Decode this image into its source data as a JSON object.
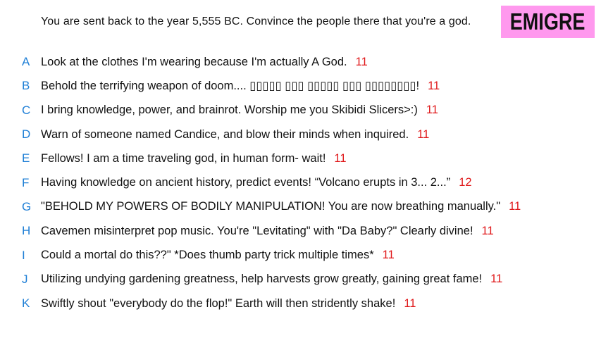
{
  "prompt": "You are sent back to the year 5,555 BC. Convince the people there that you're a god.",
  "badge": "EMIGRE",
  "colors": {
    "letter": "#1f7fd6",
    "score": "#e0191b",
    "badge_bg": "#ff99ee"
  },
  "entries": [
    {
      "letter": "A",
      "text": "Look at the clothes I'm wearing because I'm actually A God.",
      "score": "11"
    },
    {
      "letter": "B",
      "text": "Behold the terrifying weapon of doom.... ▯▯▯▯▯ ▯▯▯ ▯▯▯▯▯ ▯▯▯ ▯▯▯▯▯▯▯▯!",
      "score": "11"
    },
    {
      "letter": "C",
      "text": "I bring knowledge, power, and brainrot. Worship me you Skibidi Slicers>:)",
      "score": "11"
    },
    {
      "letter": "D",
      "text": "Warn of someone named Candice, and blow their minds when inquired.",
      "score": "11"
    },
    {
      "letter": "E",
      "text": "Fellows! I am a time traveling god, in human form- wait!",
      "score": "11"
    },
    {
      "letter": "F",
      "text": "Having knowledge on ancient history, predict events! “Volcano erupts in 3... 2...”",
      "score": "12"
    },
    {
      "letter": "G",
      "text": "\"BEHOLD MY POWERS OF BODILY MANIPULATION! You are now breathing manually.\"",
      "score": "11"
    },
    {
      "letter": "H",
      "text": "Cavemen misinterpret pop music. You're \"Levitating\" with \"Da Baby?\" Clearly divine!",
      "score": "11"
    },
    {
      "letter": "I",
      "text": "Could a mortal do this??\" *Does thumb party trick multiple times*",
      "score": "11"
    },
    {
      "letter": "J",
      "text": "Utilizing undying gardening greatness, help harvests grow greatly, gaining great fame!",
      "score": "11"
    },
    {
      "letter": "K",
      "text": "Swiftly shout \"everybody do the flop!\" Earth will then stridently shake!",
      "score": "11"
    }
  ]
}
